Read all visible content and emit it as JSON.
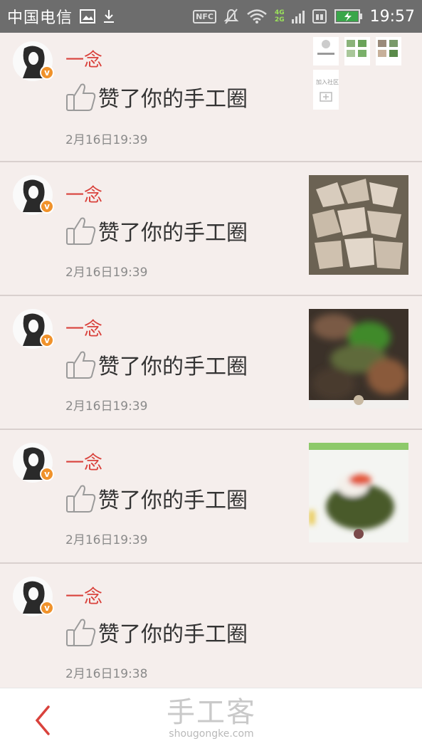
{
  "status_bar": {
    "carrier": "中国电信",
    "nfc": "NFC",
    "net_top": "4G",
    "net_bottom": "2G",
    "time": "19:57"
  },
  "notifications": [
    {
      "name": "一念",
      "action": "赞了你的手工圈",
      "time": "2月16日19:39",
      "thumb": "screenshot-collage",
      "thumb_labels": [
        "加入社区"
      ]
    },
    {
      "name": "一念",
      "action": "赞了你的手工圈",
      "time": "2月16日19:39",
      "thumb": "paper-strips-photo"
    },
    {
      "name": "一念",
      "action": "赞了你的手工圈",
      "time": "2月16日19:39",
      "thumb": "blurred-green-dish-photo"
    },
    {
      "name": "一念",
      "action": "赞了你的手工圈",
      "time": "2月16日19:39",
      "thumb": "blurred-sushi-photo"
    },
    {
      "name": "一念",
      "action": "赞了你的手工圈",
      "time": "2月16日19:38",
      "thumb": null
    }
  ],
  "bottom_bar": {
    "back_icon": "chevron-left-icon",
    "logo_cn": "手工客",
    "logo_en": "shougongke.com"
  },
  "colors": {
    "accent_name": "#d9423c",
    "badge": "#f0922b",
    "background": "#f5eeec"
  }
}
